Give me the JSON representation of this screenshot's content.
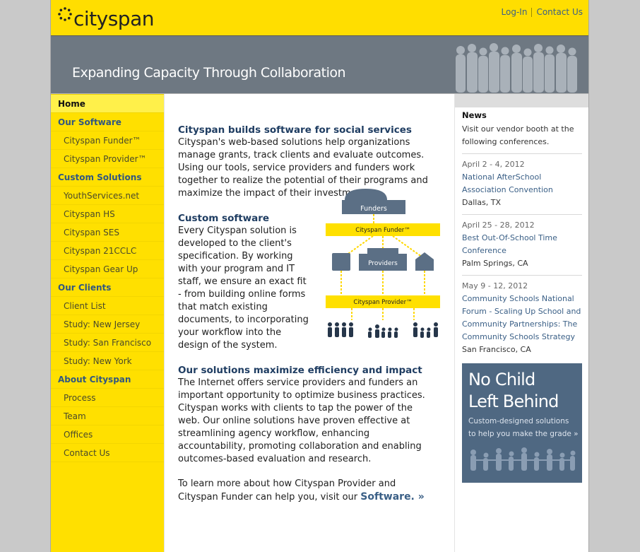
{
  "brand": {
    "logo_text": "cityspan"
  },
  "header": {
    "links": [
      "Log-In",
      "Contact Us"
    ],
    "tagline": "Expanding Capacity Through Collaboration"
  },
  "nav": {
    "home": "Home",
    "items": [
      {
        "label": "Our Software",
        "type": "section"
      },
      {
        "label": "Cityspan Funder™",
        "type": "sub"
      },
      {
        "label": "Cityspan Provider™",
        "type": "sub"
      },
      {
        "label": "Custom Solutions",
        "type": "section"
      },
      {
        "label": "YouthServices.net",
        "type": "sub"
      },
      {
        "label": "Cityspan HS",
        "type": "sub"
      },
      {
        "label": "Cityspan SES",
        "type": "sub"
      },
      {
        "label": "Cityspan 21CCLC",
        "type": "sub"
      },
      {
        "label": "Cityspan Gear Up",
        "type": "sub"
      },
      {
        "label": "Our Clients",
        "type": "section"
      },
      {
        "label": "Client List",
        "type": "sub"
      },
      {
        "label": "Study: New Jersey",
        "type": "sub"
      },
      {
        "label": "Study: San Francisco",
        "type": "sub"
      },
      {
        "label": "Study: New York",
        "type": "sub"
      },
      {
        "label": "About Cityspan",
        "type": "section"
      },
      {
        "label": "Process",
        "type": "sub"
      },
      {
        "label": "Team",
        "type": "sub"
      },
      {
        "label": "Offices",
        "type": "sub"
      },
      {
        "label": "Contact Us",
        "type": "sub"
      }
    ]
  },
  "main": {
    "s1_heading": "Cityspan builds software for social services",
    "s1_body": "Cityspan's web-based solutions help organizations manage grants, track clients and evaluate outcomes. Using our tools, service providers and funders work together to realize the potential of their programs and maximize the impact of their investments.",
    "s2_heading": "Custom software",
    "s2_body": "Every Cityspan solution is developed to the client's specification. By working with your program and IT staff, we ensure an exact fit - from building online forms that match existing documents, to incorporating your workflow into the design of the system.",
    "s3_heading": "Our solutions maximize efficiency and impact",
    "s3_body": "The Internet offers service providers and funders an important opportunity to optimize business practices. Cityspan works with clients to tap the power of the web. Our online solutions have proven effective at streamlining agency workflow, enhancing accountability, promoting collaboration and enabling outcomes-based evaluation and research.",
    "s4_body": "To learn more about how Cityspan Provider and Cityspan Funder can help you, visit our",
    "s4_link": "Software. »",
    "diagram": {
      "funders": "Funders",
      "funder_bar": "Cityspan Funder™",
      "providers": "Providers",
      "provider_bar": "Cityspan Provider™"
    }
  },
  "news": {
    "title": "News",
    "intro": "Visit our vendor booth at the following conferences.",
    "items": [
      {
        "date": "April 2 - 4, 2012",
        "title": "National AfterSchool Association Convention",
        "location": "Dallas, TX"
      },
      {
        "date": "April 25 - 28, 2012",
        "title": "Best Out-Of-School Time Conference",
        "location": "Palm Springs, CA"
      },
      {
        "date": "May 9 - 12, 2012",
        "title": "Community Schools National Forum - Scaling Up School and Community Partnerships: The Community Schools Strategy",
        "location": "San Francisco, CA"
      }
    ]
  },
  "promo": {
    "title_line1": "No Child",
    "title_line2": "Left Behind",
    "sub_line1": "Custom-designed solutions",
    "sub_line2": "to help you make the grade »"
  },
  "colors": {
    "yellow": "#ffde00",
    "banner": "#6e7882",
    "navy": "#1f3d62",
    "link": "#3a5f86",
    "promo": "#4f6882"
  }
}
